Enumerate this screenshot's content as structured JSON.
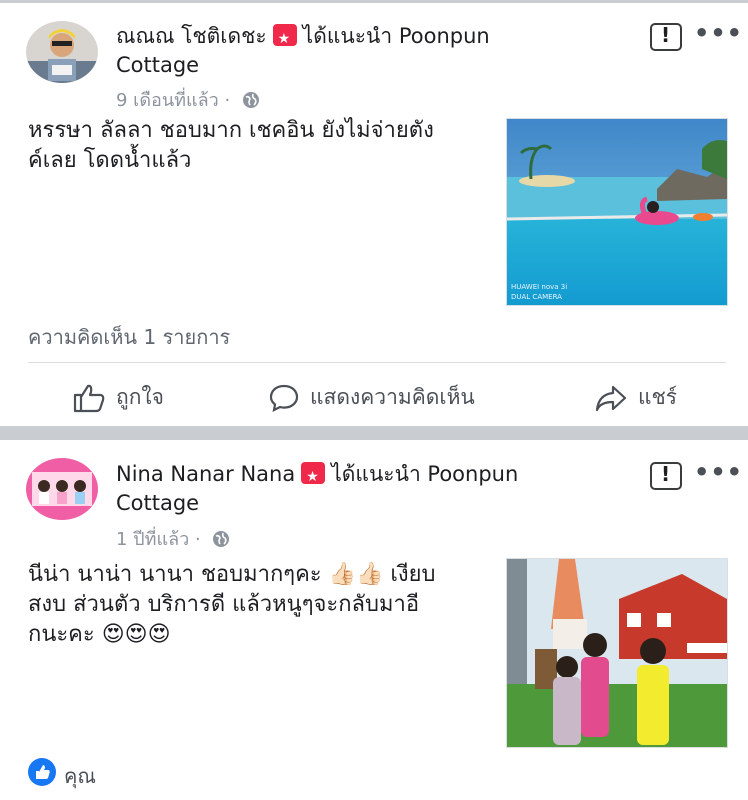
{
  "posts": [
    {
      "author": "ณณณ โชติเดชะ",
      "recommends_text": "ได้แนะนำ Poonpun",
      "page_name": "Cottage",
      "time": "9 เดือนที่แล้ว",
      "dot": "·",
      "text_line1": "หรรษา ลัลลา ชอบมาก เชคอิน ยังไม่จ่ายตัง",
      "text_line2": "ค์เลย โดดน้ำแล้ว",
      "photo_caption_line1": "HUAWEI nova 3i",
      "photo_caption_line2": "DUAL CAMERA",
      "comments": "ความคิดเห็น 1 รายการ",
      "actions": {
        "like": "ถูกใจ",
        "comment": "แสดงความคิดเห็น",
        "share": "แชร์"
      }
    },
    {
      "author": "Nina Nanar Nana",
      "recommends_text": "ได้แนะนำ Poonpun",
      "page_name": "Cottage",
      "time": "1 ปีที่แล้ว",
      "dot": "·",
      "text_line1": "นีน่า นาน่า นานา ชอบมากๆคะ 👍🏻👍🏻 เงียบ",
      "text_line2": "สงบ ส่วนตัว บริการดี แล้วหนูๆจะกลับมาอี",
      "text_line3": "กนะคะ 😍😍😍",
      "reaction_name": "คุณ"
    }
  ],
  "icons": {
    "recommend": "recommend-star-icon",
    "globe": "globe-icon",
    "report": "report-icon",
    "more": "more-icon",
    "like": "thumbs-up-icon",
    "comment": "comment-icon",
    "share": "share-icon"
  },
  "colors": {
    "recommend_red": "#f0284a",
    "like_blue": "#1877f2",
    "separator": "#c9ccd1"
  }
}
